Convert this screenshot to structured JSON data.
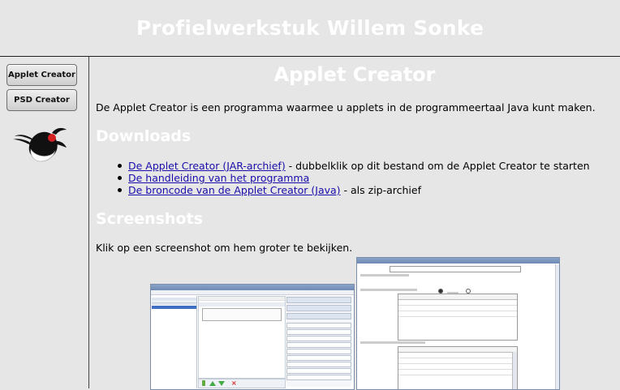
{
  "site": {
    "title": "Profielwerkstuk Willem Sonke"
  },
  "sidebar": {
    "items": [
      {
        "label": "Applet Creator"
      },
      {
        "label": "PSD Creator"
      }
    ]
  },
  "main": {
    "title": "Applet Creator",
    "intro": "De Applet Creator is een programma waarmee u applets in de programmeertaal Java kunt maken.",
    "downloads": {
      "heading": "Downloads",
      "items": [
        {
          "link": "De Applet Creator (JAR-archief)",
          "suffix": " - dubbelklik op dit bestand om de Applet Creator te starten"
        },
        {
          "link": "De handleiding van het programma",
          "suffix": ""
        },
        {
          "link": "De broncode van de Applet Creator (Java)",
          "suffix": " - als zip-archief"
        }
      ]
    },
    "screenshots": {
      "heading": "Screenshots",
      "note": "Klik op een screenshot om hem groter te bekijken."
    }
  },
  "colors": {
    "heading": "#ffffff",
    "link": "#1a0dab",
    "background": "#e6e6e6"
  }
}
